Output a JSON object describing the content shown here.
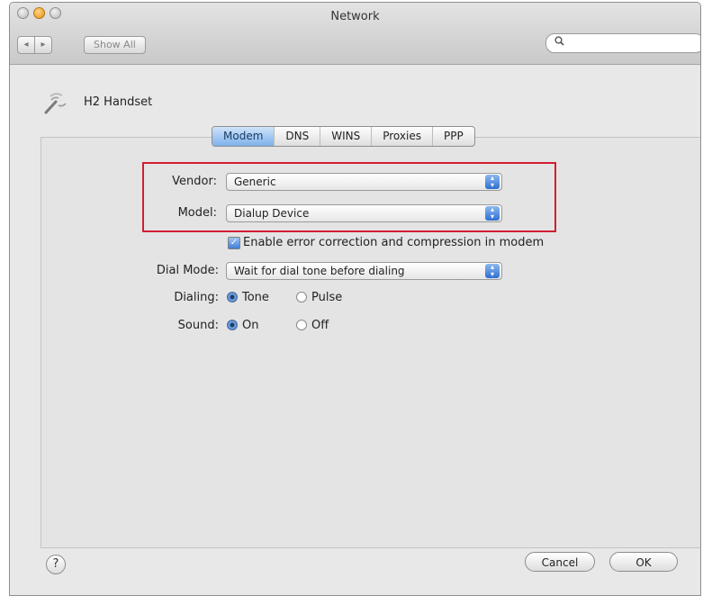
{
  "window": {
    "title": "Network"
  },
  "toolbar": {
    "back_label": "◂",
    "forward_label": "▸",
    "show_all_label": "Show All",
    "search_placeholder": "",
    "search_icon": "magnifier-icon"
  },
  "device": {
    "name": "H2 Handset",
    "icon": "antenna-icon"
  },
  "tabs": [
    {
      "label": "Modem",
      "active": true
    },
    {
      "label": "DNS",
      "active": false
    },
    {
      "label": "WINS",
      "active": false
    },
    {
      "label": "Proxies",
      "active": false
    },
    {
      "label": "PPP",
      "active": false
    }
  ],
  "form": {
    "vendor_label": "Vendor:",
    "vendor_value": "Generic",
    "model_label": "Model:",
    "model_value": "Dialup Device",
    "error_correction_label": "Enable error correction and compression in modem",
    "error_correction_checked": true,
    "dial_mode_label": "Dial Mode:",
    "dial_mode_value": "Wait for dial tone before dialing",
    "dialing_label": "Dialing:",
    "dialing_options": [
      "Tone",
      "Pulse"
    ],
    "dialing_selected": "Tone",
    "sound_label": "Sound:",
    "sound_options": [
      "On",
      "Off"
    ],
    "sound_selected": "On"
  },
  "footer": {
    "help_label": "?",
    "cancel_label": "Cancel",
    "ok_label": "OK"
  },
  "colors": {
    "highlight_border": "#d31d34",
    "accent_blue": "#3f7fd9"
  }
}
